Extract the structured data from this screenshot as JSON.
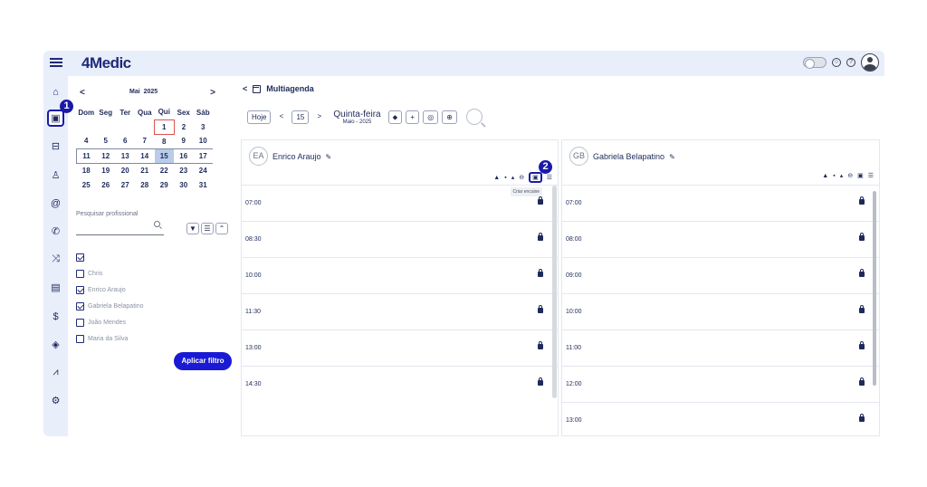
{
  "app": {
    "logo": "4Medic",
    "help_glyph": "?",
    "chat_glyph": "○"
  },
  "sidebar": {
    "items": [
      {
        "name": "home",
        "glyph": "⌂"
      },
      {
        "name": "calendar",
        "glyph": "▣",
        "active": true
      },
      {
        "name": "waiting-room",
        "glyph": "⊟"
      },
      {
        "name": "patients",
        "glyph": "♙"
      },
      {
        "name": "email",
        "glyph": "@"
      },
      {
        "name": "phone",
        "glyph": "✆"
      },
      {
        "name": "shuffle",
        "glyph": "⤨"
      },
      {
        "name": "clipboard",
        "glyph": "▤"
      },
      {
        "name": "finance",
        "glyph": "$"
      },
      {
        "name": "package",
        "glyph": "◈"
      },
      {
        "name": "chart",
        "glyph": "⩘"
      },
      {
        "name": "settings",
        "glyph": "⚙"
      }
    ],
    "badge1": "1"
  },
  "calendar": {
    "prev": "<",
    "next": ">",
    "month": "Mai",
    "year": "2025",
    "weekdays": [
      "Dom",
      "Seg",
      "Ter",
      "Qua",
      "Qui",
      "Sex",
      "Sáb"
    ],
    "weeks": [
      [
        "",
        "",
        "",
        "",
        "1",
        "2",
        "3"
      ],
      [
        "4",
        "5",
        "6",
        "7",
        "8",
        "9",
        "10"
      ],
      [
        "11",
        "12",
        "13",
        "14",
        "15",
        "16",
        "17"
      ],
      [
        "18",
        "19",
        "20",
        "21",
        "22",
        "23",
        "24"
      ],
      [
        "25",
        "26",
        "27",
        "28",
        "29",
        "30",
        "31"
      ]
    ]
  },
  "filter": {
    "search_label": "Pesquisar profissional",
    "buttons": [
      "▼",
      "☰",
      "⌃"
    ],
    "professionals": [
      {
        "label": "",
        "checked": true
      },
      {
        "label": "Chris",
        "checked": false
      },
      {
        "label": "Enrico Araujo",
        "checked": true
      },
      {
        "label": "Gabriela Belapatino",
        "checked": true
      },
      {
        "label": "João Mendes",
        "checked": false
      },
      {
        "label": "Maria da Silva",
        "checked": false
      }
    ],
    "apply_label": "Aplicar filtro"
  },
  "main": {
    "back": "<",
    "title": "Multiagenda",
    "today_label": "Hoje",
    "prev": "<",
    "day_number": "15",
    "next": ">",
    "weekday": "Quinta-feira",
    "month_year": "Maio - 2025",
    "tool_glyphs": [
      "⬥",
      "+",
      "◎",
      "⊕"
    ]
  },
  "columns": [
    {
      "initials": "EA",
      "name": "Enrico Araujo",
      "edit_glyph": "✎",
      "icons": [
        "▲",
        "▪",
        "▴",
        "⊖",
        "▣",
        "☰"
      ],
      "badge2": "2",
      "tooltip": "Criar encaixe",
      "slots": [
        "07:00",
        "08:30",
        "10:00",
        "11:30",
        "13:00",
        "14:30"
      ]
    },
    {
      "initials": "GB",
      "name": "Gabriela Belapatino",
      "edit_glyph": "✎",
      "icons": [
        "▲",
        "▪",
        "▴",
        "⊖",
        "▣",
        "☰"
      ],
      "slots": [
        "07:00",
        "08:00",
        "09:00",
        "10:00",
        "11:00",
        "12:00",
        "13:00"
      ]
    }
  ]
}
